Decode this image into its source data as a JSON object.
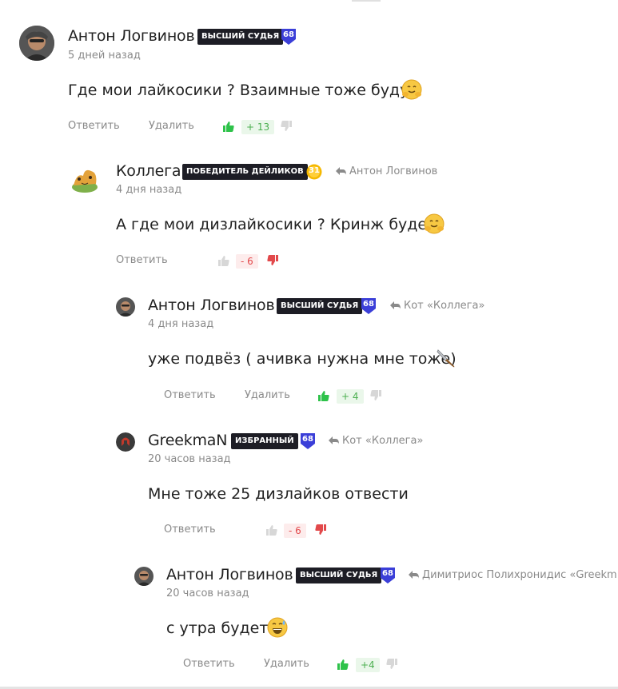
{
  "comments": [
    {
      "author": "Антон Логвинов",
      "badge": "ВЫСШИЙ СУДЬЯ",
      "level": "68",
      "time": "5 дней назад",
      "text": "Где мои лайкосики ? Взаимные тоже будут",
      "reply_label": "Ответить",
      "delete_label": "Удалить",
      "score": "+ 13"
    },
    {
      "author": "Коллега",
      "badge": "ПОБЕДИТЕЛЬ ДЕЙЛИКОВ",
      "level": "31",
      "reply_to": "Антон Логвинов",
      "time": "4 дня назад",
      "text": "А где мои дизлайкосики ? Кринж будет",
      "reply_label": "Ответить",
      "score": "- 6"
    },
    {
      "author": "Антон Логвинов",
      "badge": "ВЫСШИЙ СУДЬЯ",
      "level": "68",
      "reply_to": "Кот «Коллега»",
      "time": "4 дня назад",
      "text": "уже подвёз ( ачивка нужна мне тоже)",
      "reply_label": "Ответить",
      "delete_label": "Удалить",
      "score": "+ 4"
    },
    {
      "author": "GreekmaN",
      "badge": "ИЗБРАННЫЙ",
      "level": "68",
      "reply_to": "Кот «Коллега»",
      "time": "20 часов назад",
      "text": "Мне тоже 25 дизлайков отвести",
      "reply_label": "Ответить",
      "score": "- 6"
    },
    {
      "author": "Антон Логвинов",
      "badge": "ВЫСШИЙ СУДЬЯ",
      "level": "68",
      "reply_to": "Димитриос Полихронидис «Greekm",
      "time": "20 часов назад",
      "text": "с утра будет",
      "reply_label": "Ответить",
      "delete_label": "Удалить",
      "score": "+4"
    }
  ],
  "colors": {
    "badge_bg": "#1d1d25",
    "level_blue": "#3b3fd8",
    "level_gold": "#f5b800",
    "like_green": "#2ec24a",
    "dislike_red": "#e2494b",
    "muted": "#8a8a8a"
  },
  "icons": {
    "reply_arrow": "reply-arrow-icon",
    "like": "thumbs-up-icon",
    "dislike": "thumbs-down-icon",
    "level_shield": "shield-icon",
    "level_coin": "coin-icon"
  }
}
